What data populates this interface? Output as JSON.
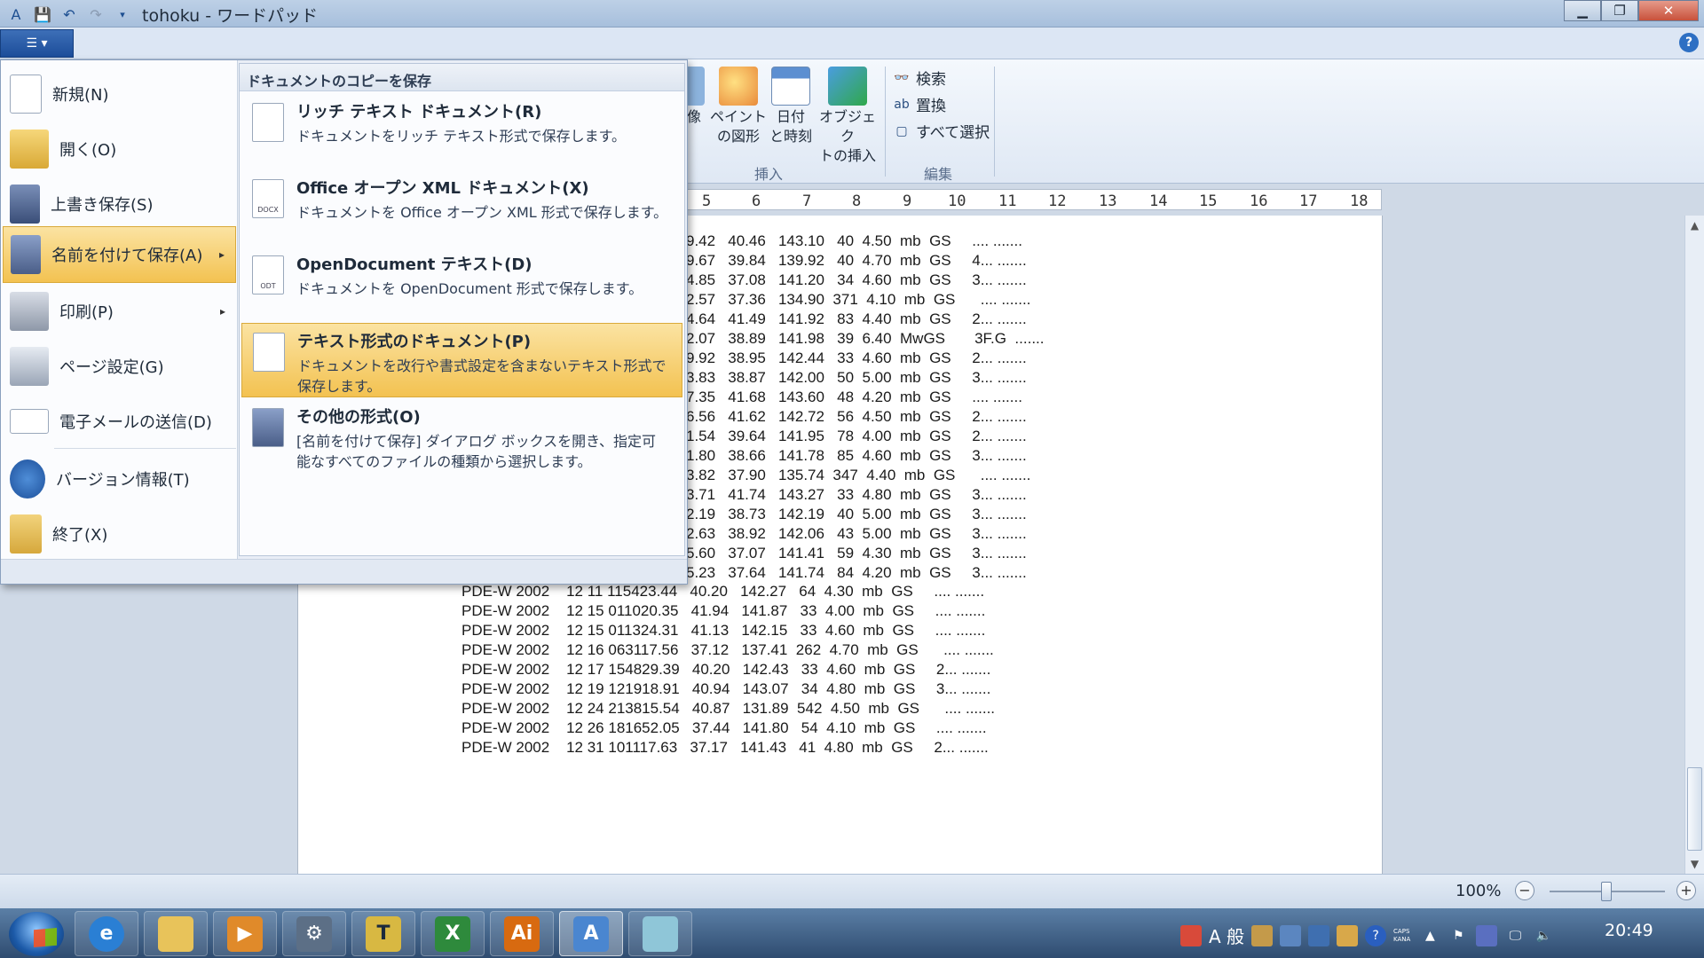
{
  "window": {
    "title": "tohoku - ワードパッド",
    "minimize_label": "▁",
    "maximize_label": "❐",
    "close_label": "✕"
  },
  "ribbon": {
    "buttons": [
      {
        "label": "像",
        "sub": ""
      },
      {
        "label": "ペイント",
        "sub": "の図形"
      },
      {
        "label": "日付",
        "sub": "と時刻"
      },
      {
        "label": "オブジェク",
        "sub": "トの挿入"
      }
    ],
    "insert_group_label": "挿入",
    "edit_items": [
      "検索",
      "置換",
      "すべて選択"
    ],
    "edit_group_label": "編集",
    "help": "?"
  },
  "ruler": {
    "ticks": [
      "5",
      "6",
      "7",
      "8",
      "9",
      "10",
      "11",
      "12",
      "13",
      "14",
      "15",
      "16",
      "17",
      "18"
    ]
  },
  "document": {
    "partial_lines": [
      "9.42   40.46   143.10   40  4.50  mb  GS     .... .......",
      "9.67   39.84   139.92   40  4.70  mb  GS     4... .......",
      "4.85   37.08   141.20   34  4.60  mb  GS     3... .......",
      "2.57   37.36   134.90  371  4.10  mb  GS      .... .......",
      "4.64   41.49   141.92   83  4.40  mb  GS     2... .......",
      "2.07   38.89   141.98   39  6.40  MwGS       3F.G  .......",
      "9.92   38.95   142.44   33  4.60  mb  GS     2... .......",
      "3.83   38.87   142.00   50  5.00  mb  GS     3... .......",
      "7.35   41.68   143.60   48  4.20  mb  GS     .... .......",
      "6.56   41.62   142.72   56  4.50  mb  GS     2... .......",
      "1.54   39.64   141.95   78  4.00  mb  GS     2... .......",
      "1.80   38.66   141.78   85  4.60  mb  GS     3... .......",
      "3.82   37.90   135.74  347  4.40  mb  GS      .... .......",
      "3.71   41.74   143.27   33  4.80  mb  GS     3... .......",
      "2.19   38.73   142.19   40  5.00  mb  GS     3... .......",
      "2.63   38.92   142.06   43  5.00  mb  GS     3... .......",
      "5.60   37.07   141.41   59  4.30  mb  GS     3... .......",
      "5.23   37.64   141.74   84  4.20  mb  GS     3... ......."
    ],
    "full_lines": [
      "PDE-W 2002    12 11 115423.44   40.20   142.27   64  4.30  mb  GS     .... .......",
      "PDE-W 2002    12 15 011020.35   41.94   141.87   33  4.00  mb  GS     .... .......",
      "PDE-W 2002    12 15 011324.31   41.13   142.15   33  4.60  mb  GS     .... .......",
      "PDE-W 2002    12 16 063117.56   37.12   137.41  262  4.70  mb  GS      .... .......",
      "PDE-W 2002    12 17 154829.39   40.20   142.43   33  4.60  mb  GS     2... .......",
      "PDE-W 2002    12 19 121918.91   40.94   143.07   34  4.80  mb  GS     3... .......",
      "PDE-W 2002    12 24 213815.54   40.87   131.89  542  4.50  mb  GS      .... .......",
      "PDE-W 2002    12 26 181652.05   37.44   141.80   54  4.10  mb  GS     .... .......",
      "PDE-W 2002    12 31 101117.63   37.17   141.43   41  4.80  mb  GS     2... ......."
    ]
  },
  "app_menu": {
    "items": [
      {
        "label": "新規(N)"
      },
      {
        "label": "開く(O)"
      },
      {
        "label": "上書き保存(S)"
      },
      {
        "label": "名前を付けて保存(A)",
        "arrow": "▸"
      },
      {
        "label": "印刷(P)",
        "arrow": "▸"
      },
      {
        "label": "ページ設定(G)"
      },
      {
        "label": "電子メールの送信(D)"
      },
      {
        "label": "バージョン情報(T)"
      },
      {
        "label": "終了(X)"
      }
    ],
    "submenu_header": "ドキュメントのコピーを保存",
    "submenu": [
      {
        "title": "リッチ テキスト ドキュメント(R)",
        "desc": "ドキュメントをリッチ テキスト形式で保存します。",
        "badge": ""
      },
      {
        "title": "Office オープン XML ドキュメント(X)",
        "desc": "ドキュメントを Office オープン XML 形式で保存します。",
        "badge": "DOCX"
      },
      {
        "title": "OpenDocument テキスト(D)",
        "desc": "ドキュメントを OpenDocument 形式で保存します。",
        "badge": "ODT"
      },
      {
        "title": "テキスト形式のドキュメント(P)",
        "desc": "ドキュメントを改行や書式設定を含まないテキスト形式で保存します。",
        "badge": ""
      },
      {
        "title": "その他の形式(O)",
        "desc": "[名前を付けて保存] ダイアログ ボックスを開き、指定可能なすべてのファイルの種類から選択します。",
        "badge": ""
      }
    ]
  },
  "statusbar": {
    "zoom": "100%",
    "zoom_out": "−",
    "zoom_in": "+"
  },
  "taskbar": {
    "apps": [
      {
        "name": "internet-explorer",
        "glyph": "e",
        "color": "#2a7fd4"
      },
      {
        "name": "explorer",
        "glyph": "",
        "color": "#e8c35a"
      },
      {
        "name": "media-player",
        "glyph": "▶",
        "color": "#e08a2a"
      },
      {
        "name": "network-tool",
        "glyph": "⚙",
        "color": "#5c6f86"
      },
      {
        "name": "text-tool",
        "glyph": "T",
        "color": "#d8b842"
      },
      {
        "name": "excel",
        "glyph": "X",
        "color": "#2e8a3c"
      },
      {
        "name": "illustrator",
        "glyph": "Ai",
        "color": "#d86a10"
      },
      {
        "name": "wordpad",
        "glyph": "A",
        "color": "#4a86d0"
      },
      {
        "name": "notepad",
        "glyph": "",
        "color": "#8fc6d8"
      }
    ],
    "ime": "A 般",
    "clock": "20:49",
    "caps": "CAPS",
    "kana": "KANA"
  },
  "colors": {
    "highlight": "#f3c251",
    "app_button": "#1c4d9a"
  }
}
